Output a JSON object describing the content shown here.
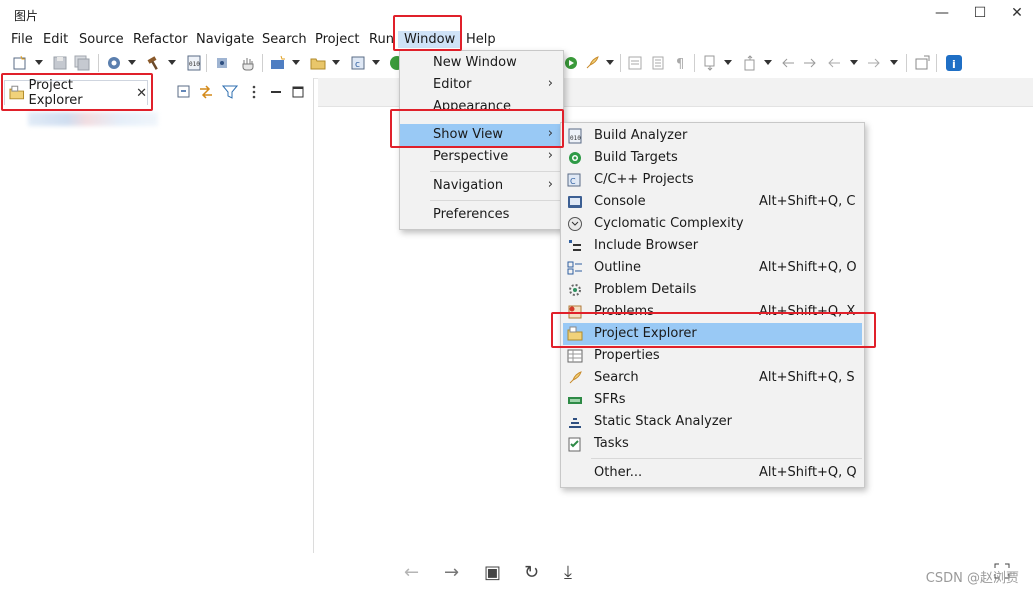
{
  "window": {
    "title": "图片"
  },
  "window_controls": {
    "minimize": "—",
    "maximize": "☐",
    "close": "✕"
  },
  "menubar": [
    "File",
    "Edit",
    "Source",
    "Refactor",
    "Navigate",
    "Search",
    "Project",
    "Run",
    "Window",
    "Help"
  ],
  "project_explorer": {
    "tab_label": "Project Explorer",
    "close_glyph": "✕"
  },
  "window_menu": {
    "items": [
      {
        "label": "New Window",
        "has_submenu": false
      },
      {
        "label": "Editor",
        "has_submenu": true
      },
      {
        "label": "Appearance",
        "has_submenu": true
      },
      {
        "label": "Show View",
        "has_submenu": true,
        "selected": true
      },
      {
        "label": "Perspective",
        "has_submenu": true
      },
      {
        "label": "Navigation",
        "has_submenu": true
      },
      {
        "label": "Preferences",
        "has_submenu": false
      }
    ],
    "arrow_glyph": "›"
  },
  "show_view_menu": {
    "items": [
      {
        "label": "Build Analyzer",
        "accel": "",
        "icon": "build-analyzer-icon"
      },
      {
        "label": "Build Targets",
        "accel": "",
        "icon": "build-targets-icon"
      },
      {
        "label": "C/C++ Projects",
        "accel": "",
        "icon": "cpp-projects-icon"
      },
      {
        "label": "Console",
        "accel": "Alt+Shift+Q, C",
        "icon": "console-icon"
      },
      {
        "label": "Cyclomatic Complexity",
        "accel": "",
        "icon": "cyclomatic-complexity-icon"
      },
      {
        "label": "Include Browser",
        "accel": "",
        "icon": "include-browser-icon"
      },
      {
        "label": "Outline",
        "accel": "Alt+Shift+Q, O",
        "icon": "outline-icon"
      },
      {
        "label": "Problem Details",
        "accel": "",
        "icon": "problem-details-icon"
      },
      {
        "label": "Problems",
        "accel": "Alt+Shift+Q, X",
        "icon": "problems-icon"
      },
      {
        "label": "Project Explorer",
        "accel": "",
        "icon": "project-explorer-icon",
        "selected": true
      },
      {
        "label": "Properties",
        "accel": "",
        "icon": "properties-icon"
      },
      {
        "label": "Search",
        "accel": "Alt+Shift+Q, S",
        "icon": "search-icon"
      },
      {
        "label": "SFRs",
        "accel": "",
        "icon": "sfrs-icon"
      },
      {
        "label": "Static Stack Analyzer",
        "accel": "",
        "icon": "static-stack-analyzer-icon"
      },
      {
        "label": "Tasks",
        "accel": "",
        "icon": "tasks-icon"
      },
      {
        "label": "Other...",
        "accel": "Alt+Shift+Q, Q",
        "icon": ""
      }
    ]
  },
  "bottom_nav": {
    "back": "←",
    "forward": "→",
    "fit": "▣",
    "rotate": "↻",
    "download": "⤓"
  },
  "watermark": "CSDN @赵浏贾",
  "colors": {
    "highlight_box": "#e0202a",
    "menu_selection": "#99c9f5",
    "menu_bg": "#f2f2f2"
  }
}
